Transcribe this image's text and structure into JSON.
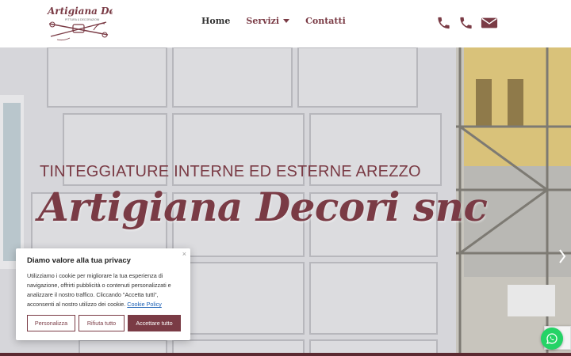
{
  "brand": {
    "logo_text": "Artigiana Decori",
    "logo_tagline": "PITTURA & DECORAZIONI",
    "color": "#7a3b45"
  },
  "nav": {
    "items": [
      {
        "label": "Home"
      },
      {
        "label": "Servizi"
      },
      {
        "label": "Contatti"
      }
    ]
  },
  "header_icons": [
    "phone-icon",
    "phone-icon",
    "envelope-icon"
  ],
  "hero": {
    "subtitle": "TINTEGGIATURE INTERNE ED ESTERNE AREZZO",
    "title": "Artigiana Decori snc"
  },
  "cookie": {
    "title": "Diamo valore alla tua privacy",
    "text": "Utilizziamo i cookie per migliorare la tua esperienza di navigazione, offrirti pubblicità o contenuti personalizzati e analizzare il nostro traffico. Cliccando \"Accetta tutti\", acconsenti al nostro utilizzo dei cookie.",
    "link": "Cookie Policy",
    "close": "×",
    "buttons": {
      "customize": "Personalizza",
      "reject": "Rifiuta tutto",
      "accept": "Accettare tutto"
    }
  }
}
